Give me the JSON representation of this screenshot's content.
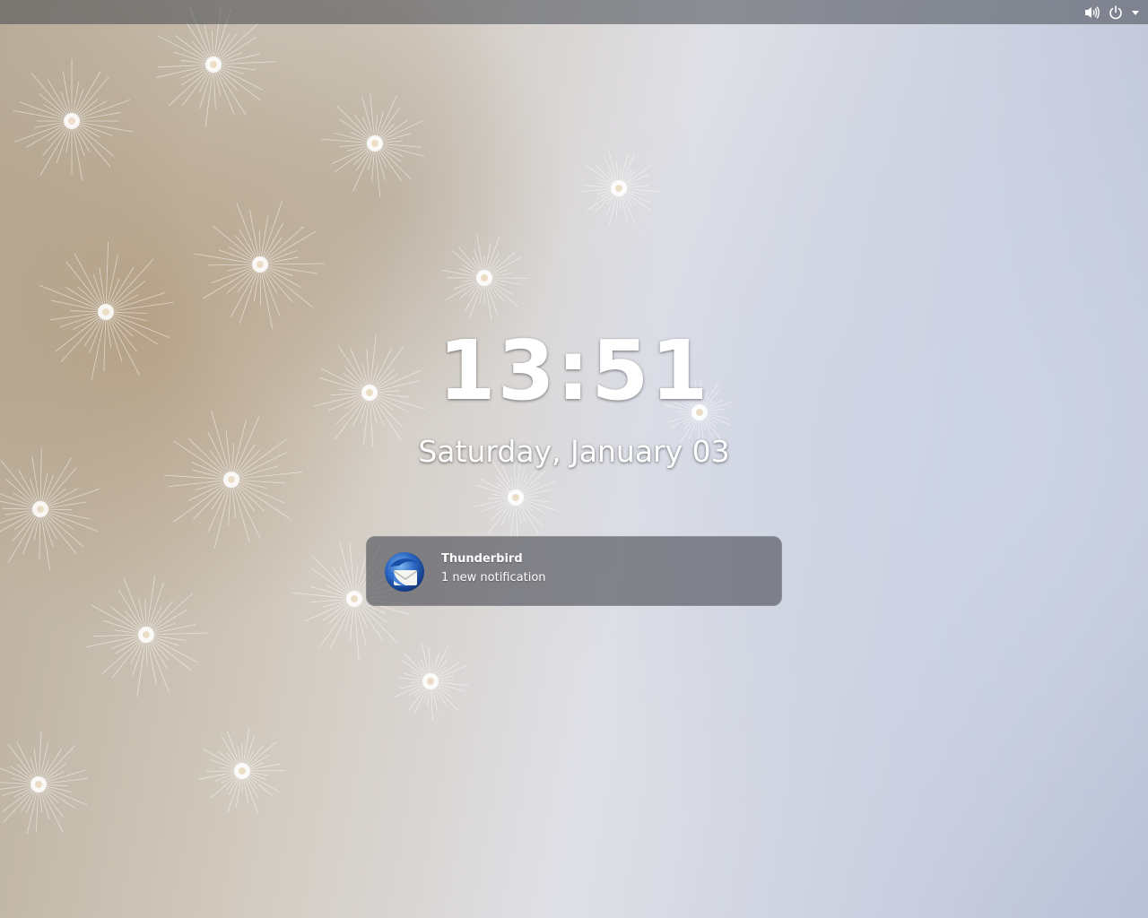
{
  "top_bar": {
    "icons": [
      "volume-icon",
      "power-icon",
      "dropdown-arrow-icon"
    ]
  },
  "clock": {
    "time": "13:51",
    "date": "Saturday, January 03"
  },
  "notification": {
    "app_name": "Thunderbird",
    "message": "1 new notification",
    "icon": "thunderbird-icon"
  },
  "colors": {
    "text": "#ffffff",
    "top_bar": "#46485080",
    "notification_bg": "#484a529e"
  }
}
